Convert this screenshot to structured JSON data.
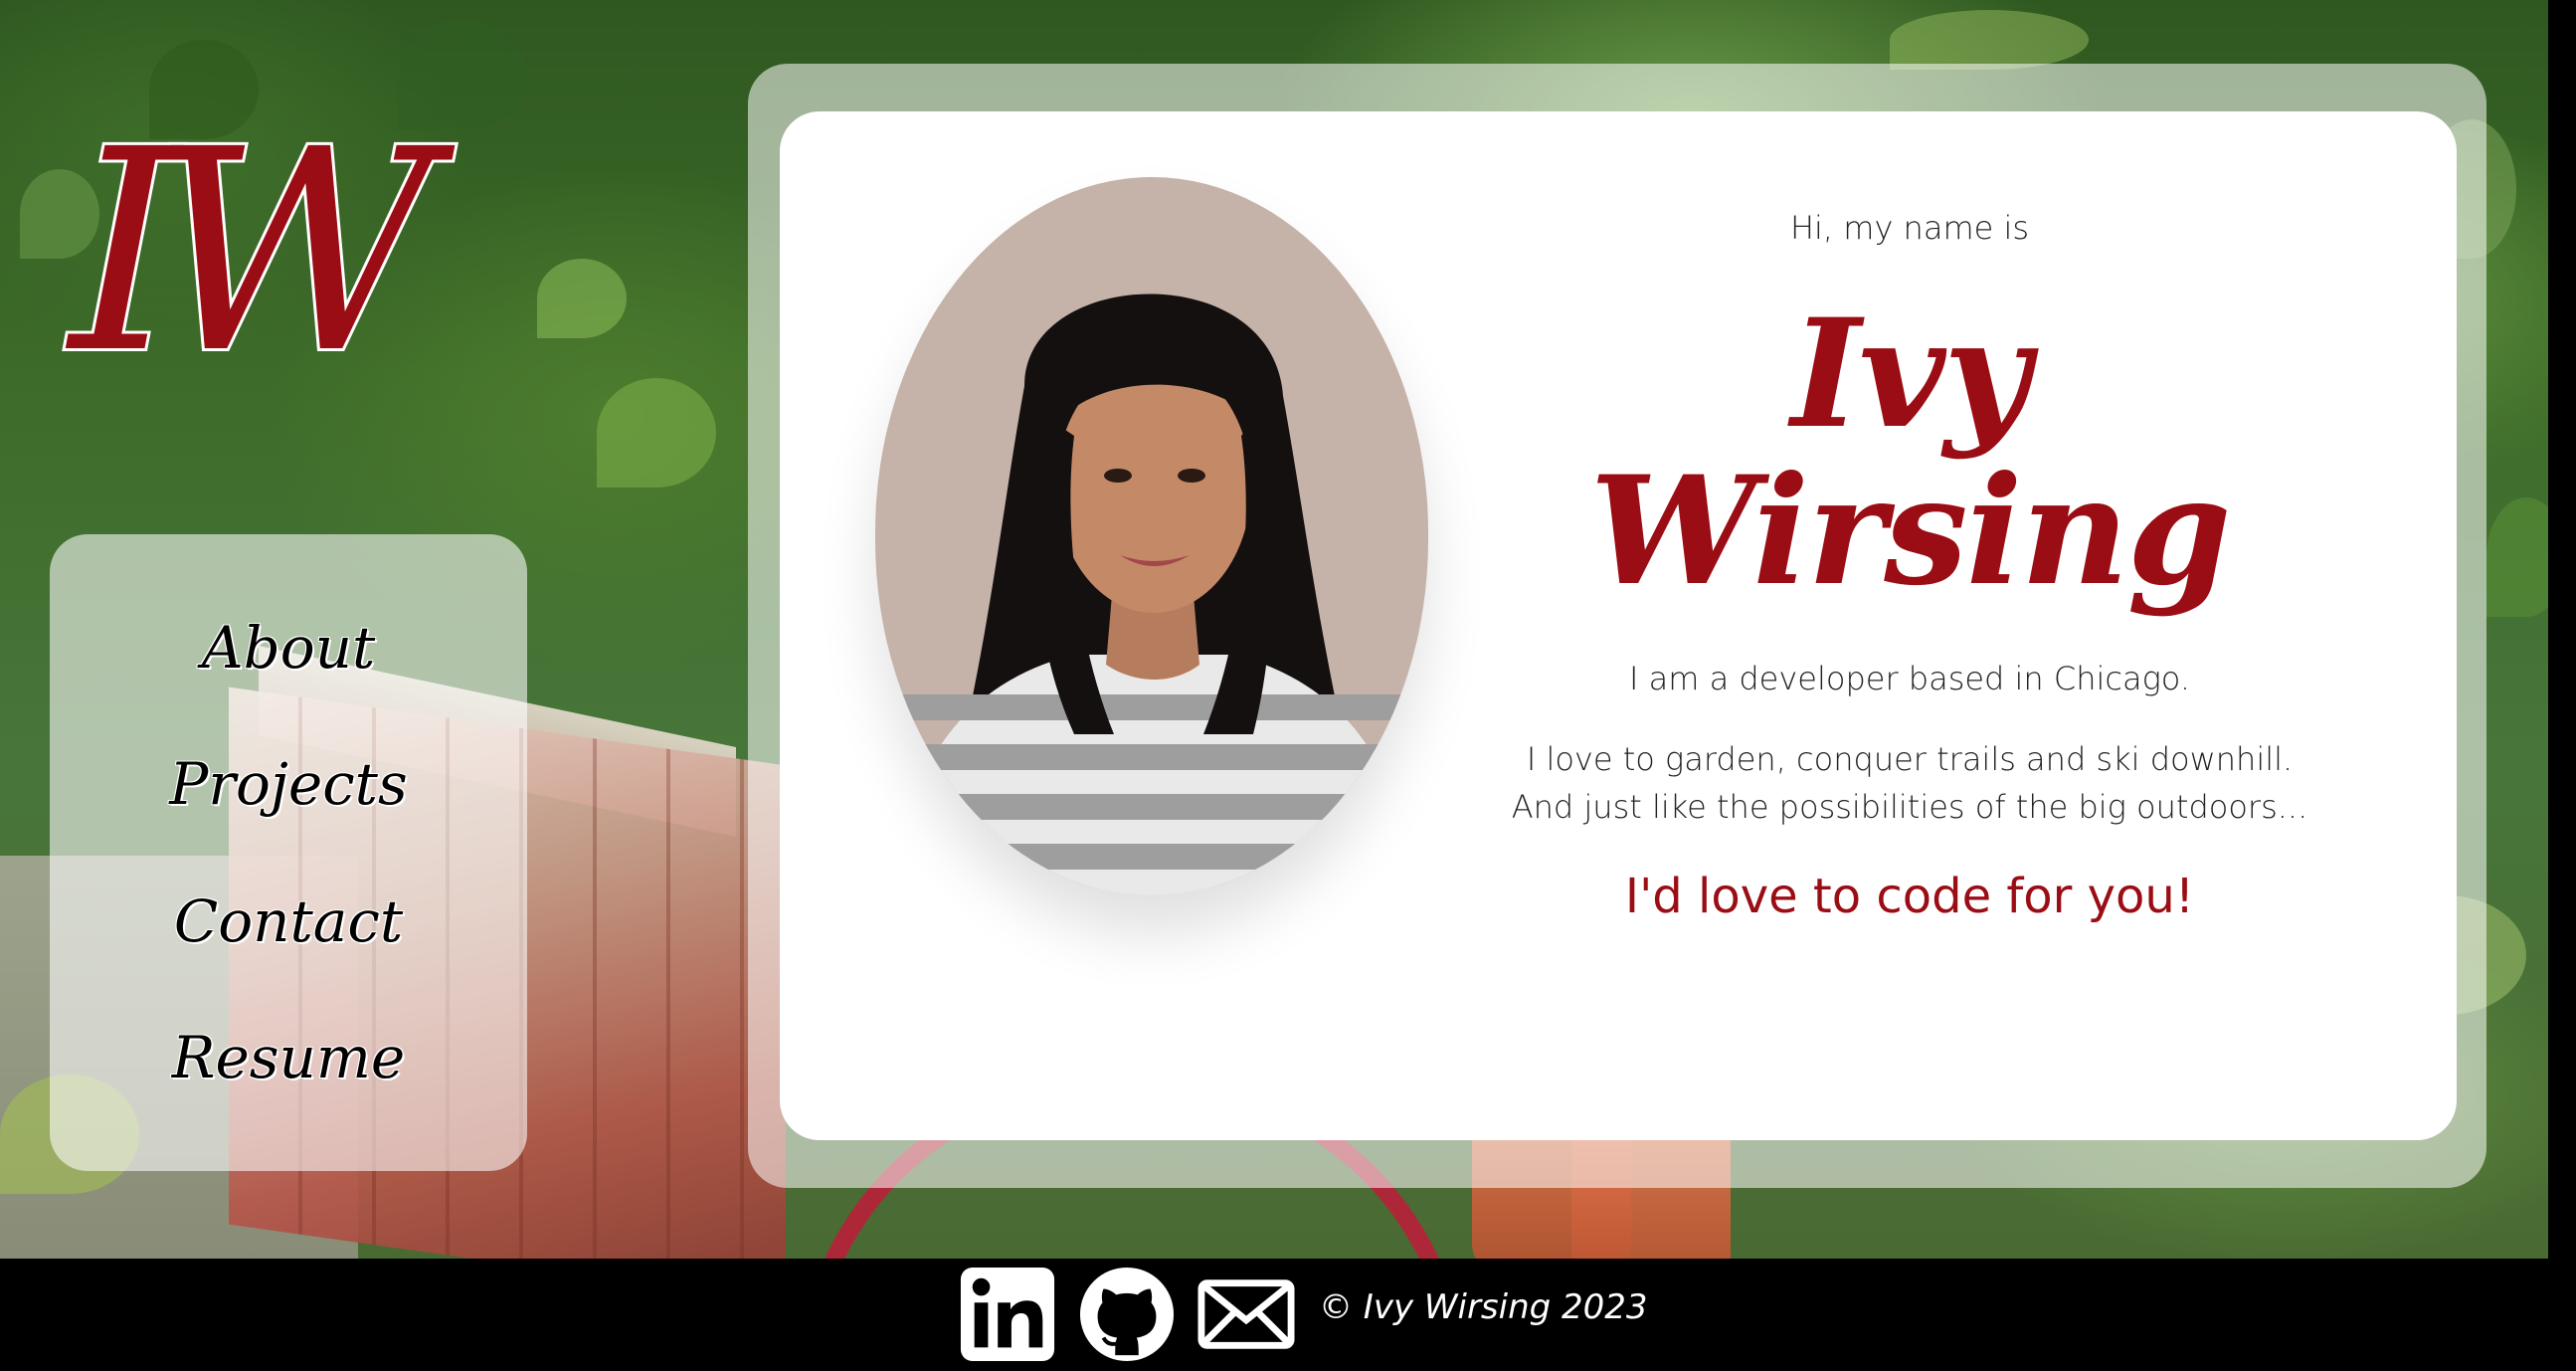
{
  "brand": {
    "monogram": "IW",
    "colors": {
      "accent": "#9b0d14",
      "footer": "#000000"
    }
  },
  "nav": {
    "items": [
      {
        "label": "About"
      },
      {
        "label": "Projects"
      },
      {
        "label": "Contact"
      },
      {
        "label": "Resume"
      }
    ]
  },
  "hero": {
    "greeting": "Hi, my name is",
    "name": "Ivy Wirsing",
    "line1": "I am a developer based in Chicago.",
    "line2": "I love to garden, conquer trails and ski downhill. And just like the possibilities of the big outdoors...",
    "cta": "I'd love to code for you!"
  },
  "footer": {
    "icons": [
      "linkedin-icon",
      "github-icon",
      "email-icon"
    ],
    "copyright": "© Ivy Wirsing 2023"
  }
}
